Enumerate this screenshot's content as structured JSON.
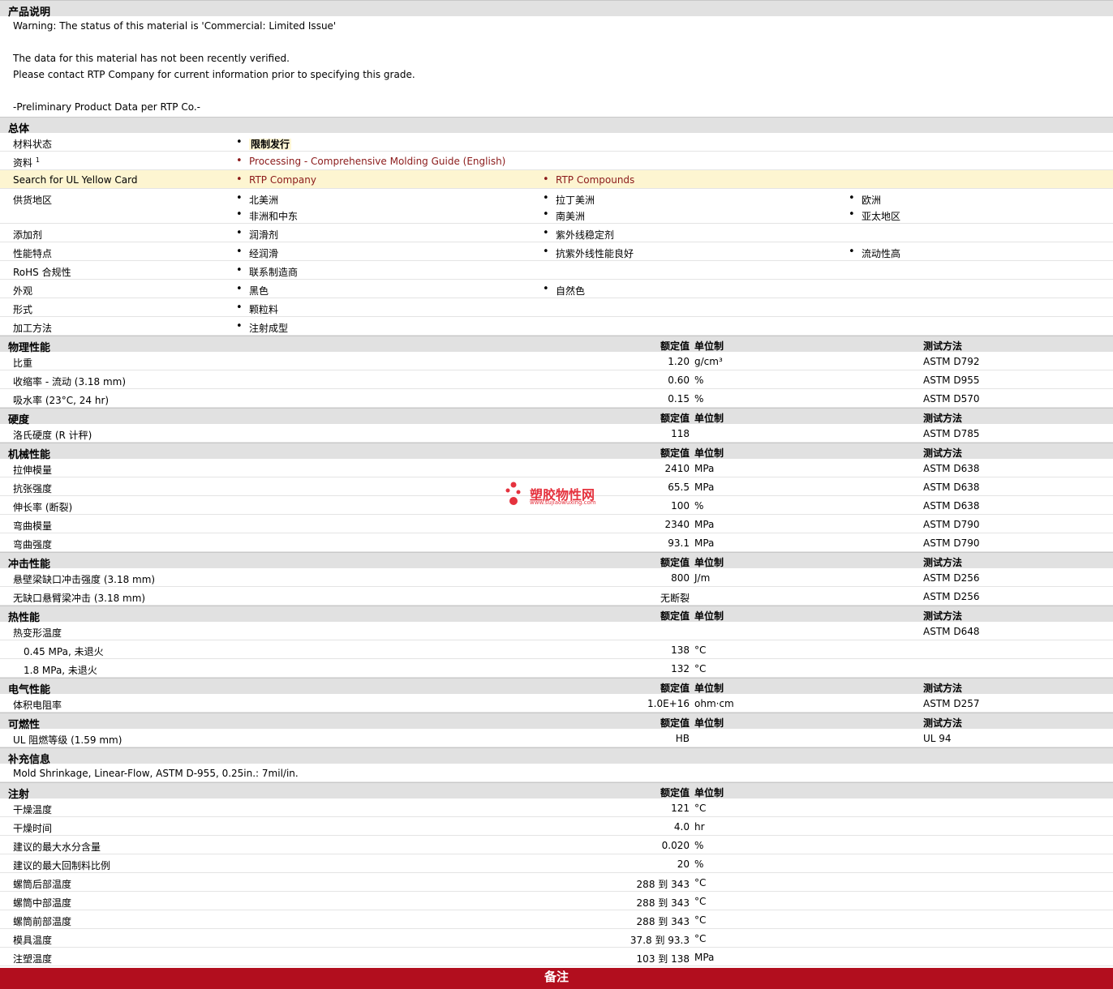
{
  "description": {
    "title": "产品说明",
    "lines": [
      "Warning: The status of this material is 'Commercial: Limited Issue'",
      "",
      "The data for this material has not been recently verified.",
      "Please contact RTP Company for current information prior to specifying this grade.",
      "",
      "-Preliminary Product Data per RTP Co.-"
    ]
  },
  "general": {
    "title": "总体",
    "material_status": {
      "label": "材料状态",
      "value": "限制发行"
    },
    "documents": {
      "label": "资料",
      "sup": "1",
      "link": "Processing - Comprehensive Molding Guide (English)"
    },
    "ul_card": {
      "label": "Search for UL Yellow Card",
      "links": [
        "RTP Company",
        "RTP Compounds"
      ]
    },
    "availability": {
      "label": "供货地区",
      "items": [
        "北美洲",
        "拉丁美洲",
        "欧洲",
        "非洲和中东",
        "南美洲",
        "亚太地区"
      ]
    },
    "additive": {
      "label": "添加剂",
      "items": [
        "润滑剂",
        "紫外线稳定剂"
      ]
    },
    "features": {
      "label": "性能特点",
      "items": [
        "经润滑",
        "抗紫外线性能良好",
        "流动性高"
      ]
    },
    "rohs": {
      "label": "RoHS 合规性",
      "items": [
        "联系制造商"
      ]
    },
    "appearance": {
      "label": "外观",
      "items": [
        "黑色",
        "自然色"
      ]
    },
    "form": {
      "label": "形式",
      "items": [
        "颗粒料"
      ]
    },
    "processing": {
      "label": "加工方法",
      "items": [
        "注射成型"
      ]
    }
  },
  "headers": {
    "value": "额定值",
    "unit": "单位制",
    "method": "测试方法"
  },
  "physical": {
    "title": "物理性能",
    "rows": [
      {
        "label": "比重",
        "value": "1.20",
        "unit": "g/cm³",
        "method": "ASTM D792"
      },
      {
        "label": "收缩率  - 流动  (3.18 mm)",
        "value": "0.60",
        "unit": "%",
        "method": "ASTM D955"
      },
      {
        "label": "吸水率  (23°C, 24 hr)",
        "value": "0.15",
        "unit": "%",
        "method": "ASTM D570"
      }
    ]
  },
  "hardness": {
    "title": "硬度",
    "rows": [
      {
        "label": "洛氏硬度  (R 计秤)",
        "value": "118",
        "unit": "",
        "method": "ASTM D785"
      }
    ]
  },
  "mechanical": {
    "title": "机械性能",
    "rows": [
      {
        "label": "拉伸模量",
        "value": "2410",
        "unit": "MPa",
        "method": "ASTM D638"
      },
      {
        "label": "抗张强度",
        "value": "65.5",
        "unit": "MPa",
        "method": "ASTM D638"
      },
      {
        "label": "伸长率  (断裂)",
        "value": "100",
        "unit": "%",
        "method": "ASTM D638"
      },
      {
        "label": "弯曲模量",
        "value": "2340",
        "unit": "MPa",
        "method": "ASTM D790"
      },
      {
        "label": "弯曲强度",
        "value": "93.1",
        "unit": "MPa",
        "method": "ASTM D790"
      }
    ]
  },
  "impact": {
    "title": "冲击性能",
    "rows": [
      {
        "label": "悬壁梁缺口冲击强度  (3.18 mm)",
        "value": "800",
        "unit": "J/m",
        "method": "ASTM D256"
      },
      {
        "label": "无缺口悬臂梁冲击  (3.18 mm)",
        "value": "无断裂",
        "unit": "",
        "method": "ASTM D256"
      }
    ]
  },
  "thermal": {
    "title": "热性能",
    "rows": [
      {
        "label": "热变形温度",
        "value": "",
        "unit": "",
        "method": "ASTM D648"
      },
      {
        "label": "0.45 MPa, 未退火",
        "value": "138",
        "unit": "°C",
        "method": ""
      },
      {
        "label": "1.8 MPa, 未退火",
        "value": "132",
        "unit": "°C",
        "method": ""
      }
    ]
  },
  "electrical": {
    "title": "电气性能",
    "rows": [
      {
        "label": "体积电阻率",
        "value": "1.0E+16",
        "unit": "ohm·cm",
        "method": "ASTM D257"
      }
    ]
  },
  "flammability": {
    "title": "可燃性",
    "rows": [
      {
        "label": "UL 阻燃等级  (1.59 mm)",
        "value": "HB",
        "unit": "",
        "method": "UL 94"
      }
    ]
  },
  "supplement": {
    "title": "补充信息",
    "text": "Mold Shrinkage, Linear-Flow, ASTM D-955, 0.25in.: 7mil/in."
  },
  "injection": {
    "title": "注射",
    "rows": [
      {
        "label": "干燥温度",
        "value": "121",
        "unit": "°C"
      },
      {
        "label": "干燥时间",
        "value": "4.0",
        "unit": "hr"
      },
      {
        "label": "建议的最大水分含量",
        "value": "0.020",
        "unit": "%"
      },
      {
        "label": "建议的最大回制料比例",
        "value": "20",
        "unit": "%"
      },
      {
        "label": "螺筒后部温度",
        "value": "288 到  343",
        "unit": "°C"
      },
      {
        "label": "螺筒中部温度",
        "value": "288 到  343",
        "unit": "°C"
      },
      {
        "label": "螺筒前部温度",
        "value": "288 到  343",
        "unit": "°C"
      },
      {
        "label": "模具温度",
        "value": "37.8 到  93.3",
        "unit": "°C"
      },
      {
        "label": "注塑温度",
        "value": "103 到  138",
        "unit": "MPa"
      }
    ]
  },
  "footer": {
    "label": "备注"
  },
  "watermark": {
    "title": "塑胶物性网",
    "url": "www.sujiaowuxing.com"
  },
  "colors": {
    "section_bg": "#e1e1e1",
    "link": "#8b1a1a",
    "highlight_row": "#fdf5d1",
    "footer_bg": "#b20e1e",
    "watermark": "#e5323e"
  }
}
